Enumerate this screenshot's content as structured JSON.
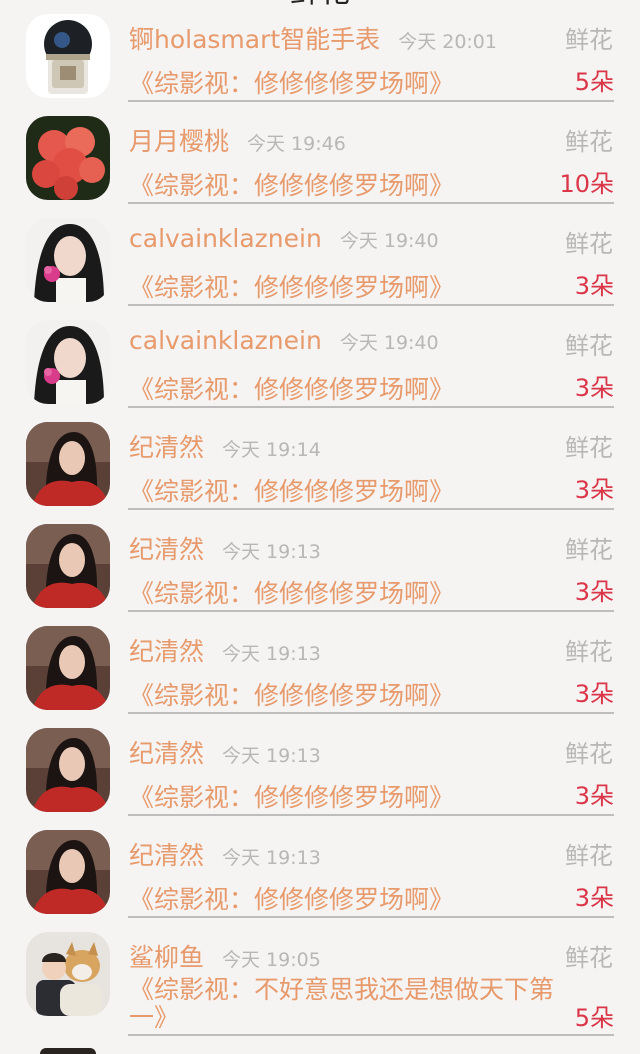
{
  "top_title_fragment": "鲜花",
  "rows": [
    {
      "name": "锕holasmart智能手表",
      "time": "今天 20:01",
      "type": "鲜花",
      "title": "《综影视：修修修修罗场啊》",
      "count": "5朵",
      "avatar": "avatar-bottle"
    },
    {
      "name": "月月樱桃",
      "time": "今天 19:46",
      "type": "鲜花",
      "title": "《综影视：修修修修罗场啊》",
      "count": "10朵",
      "avatar": "avatar-flower"
    },
    {
      "name": "calvainklaznein",
      "time": "今天 19:40",
      "type": "鲜花",
      "title": "《综影视：修修修修罗场啊》",
      "count": "3朵",
      "avatar": "avatar-girl-flower"
    },
    {
      "name": "calvainklaznein",
      "time": "今天 19:40",
      "type": "鲜花",
      "title": "《综影视：修修修修罗场啊》",
      "count": "3朵",
      "avatar": "avatar-girl-flower"
    },
    {
      "name": "纪清然",
      "time": "今天 19:14",
      "type": "鲜花",
      "title": "《综影视：修修修修罗场啊》",
      "count": "3朵",
      "avatar": "avatar-red-dress"
    },
    {
      "name": "纪清然",
      "time": "今天 19:13",
      "type": "鲜花",
      "title": "《综影视：修修修修罗场啊》",
      "count": "3朵",
      "avatar": "avatar-red-dress"
    },
    {
      "name": "纪清然",
      "time": "今天 19:13",
      "type": "鲜花",
      "title": "《综影视：修修修修罗场啊》",
      "count": "3朵",
      "avatar": "avatar-red-dress"
    },
    {
      "name": "纪清然",
      "time": "今天 19:13",
      "type": "鲜花",
      "title": "《综影视：修修修修罗场啊》",
      "count": "3朵",
      "avatar": "avatar-red-dress"
    },
    {
      "name": "纪清然",
      "time": "今天 19:13",
      "type": "鲜花",
      "title": "《综影视：修修修修罗场啊》",
      "count": "3朵",
      "avatar": "avatar-red-dress"
    },
    {
      "name": "鲨柳鱼",
      "time": "今天 19:05",
      "type": "鲜花",
      "title": "《综影视：不好意思我还是想做天下第一》",
      "count": "5朵",
      "avatar": "avatar-child-dog"
    }
  ]
}
